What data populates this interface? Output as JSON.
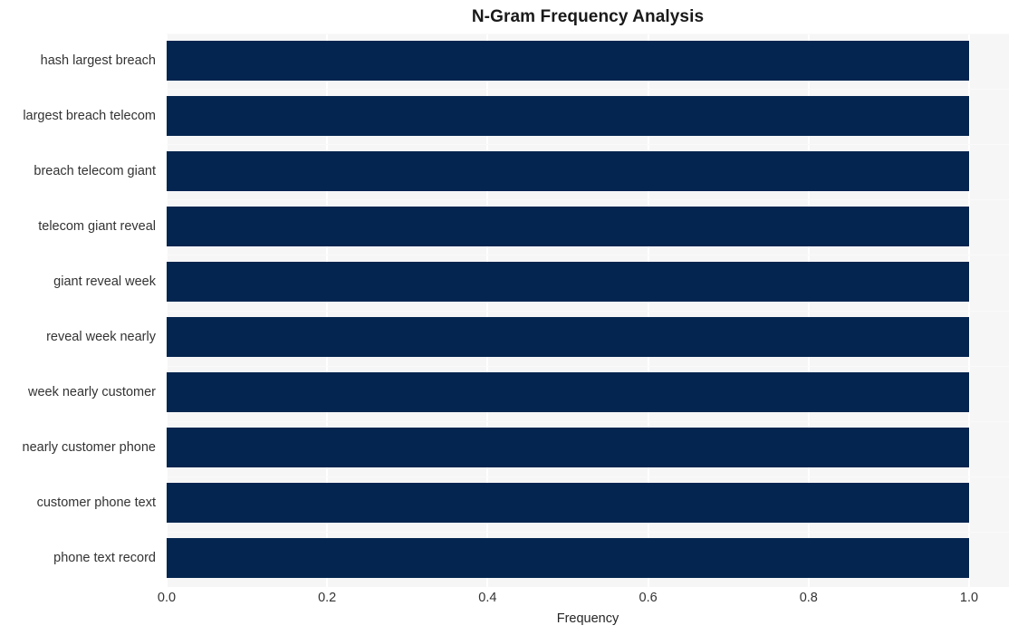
{
  "chart_data": {
    "type": "bar",
    "orientation": "horizontal",
    "title": "N-Gram Frequency Analysis",
    "xlabel": "Frequency",
    "ylabel": "",
    "xlim": [
      0.0,
      1.0
    ],
    "grid": true,
    "legend": null,
    "bar_color": "#04254f",
    "plot_background": "#f6f6f7",
    "figure_background": "#ffffff",
    "xticks": [
      "0.0",
      "0.2",
      "0.4",
      "0.6",
      "0.8",
      "1.0"
    ],
    "xtick_values": [
      0.0,
      0.2,
      0.4,
      0.6,
      0.8,
      1.0
    ],
    "categories": [
      "hash largest breach",
      "largest breach telecom",
      "breach telecom giant",
      "telecom giant reveal",
      "giant reveal week",
      "reveal week nearly",
      "week nearly customer",
      "nearly customer phone",
      "customer phone text",
      "phone text record"
    ],
    "values": [
      1.0,
      1.0,
      1.0,
      1.0,
      1.0,
      1.0,
      1.0,
      1.0,
      1.0,
      1.0
    ]
  }
}
